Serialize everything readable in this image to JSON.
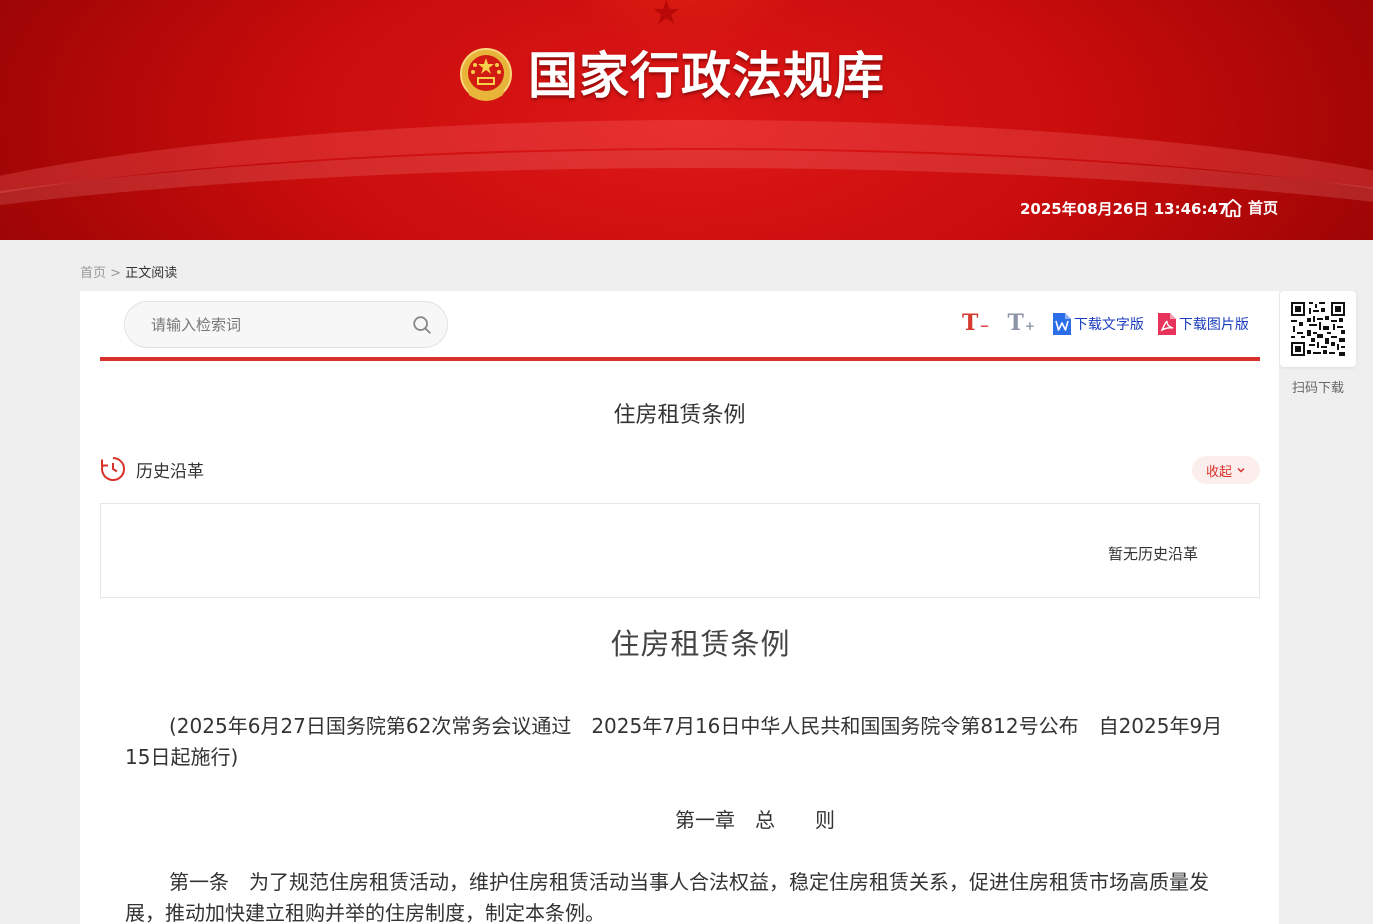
{
  "header": {
    "site_title": "国家行政法规库",
    "datetime": "2025年08月26日 13:46:47",
    "home_label": "首页"
  },
  "breadcrumb": {
    "home": "首页",
    "separator": " > ",
    "current": "正文阅读"
  },
  "toolbar": {
    "search_placeholder": "请输入检索词",
    "font_decrease": "T",
    "font_decrease_sign": "−",
    "font_increase": "T",
    "font_increase_sign": "+",
    "download_text": "下载文字版",
    "download_image": "下载图片版"
  },
  "document": {
    "title": "住房租赁条例",
    "history_label": "历史沿革",
    "collapse_label": "收起",
    "history_empty": "暂无历史沿革",
    "main_title": "住房租赁条例",
    "meta": "(2025年6月27日国务院第62次常务会议通过　2025年7月16日中华人民共和国国务院令第812号公布　自2025年9月15日起施行)",
    "chapter_1": "第一章　总　　则",
    "article_1": "第一条　为了规范住房租赁活动，维护住房租赁活动当事人合法权益，稳定住房租赁关系，促进住房租赁市场高质量发展，推动加快建立租购并举的住房制度，制定本条例。"
  },
  "sidebar": {
    "qr_label": "扫码下载"
  },
  "colors": {
    "brand_red": "#d8312a",
    "link_blue": "#1a3dbf"
  }
}
